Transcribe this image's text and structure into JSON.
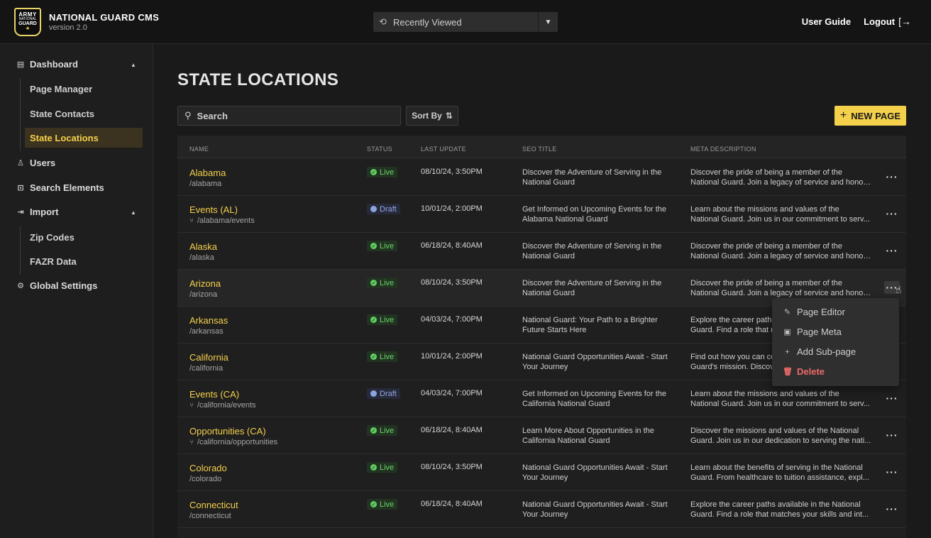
{
  "app": {
    "logo": {
      "line1": "ARMY",
      "line2": "NATIONAL",
      "line3": "GUARD"
    },
    "title": "NATIONAL GUARD CMS",
    "version": "version 2.0"
  },
  "recent": {
    "label": "Recently Viewed"
  },
  "topnav": {
    "guide": "User Guide",
    "logout": "Logout"
  },
  "sidebar": {
    "dashboard": "Dashboard",
    "page_manager": "Page Manager",
    "state_contacts": "State Contacts",
    "state_locations": "State Locations",
    "users": "Users",
    "search_elements": "Search Elements",
    "import": "Import",
    "zip_codes": "Zip Codes",
    "fazr_data": "FAZR Data",
    "global_settings": "Global Settings"
  },
  "page": {
    "title": "STATE LOCATIONS",
    "search_placeholder": "Search",
    "sort_label": "Sort By",
    "new_page": "NEW PAGE"
  },
  "table": {
    "headers": {
      "name": "NAME",
      "status": "STATUS",
      "updated": "LAST UPDATE",
      "seo": "SEO TITLE",
      "meta": "META DESCRIPTION"
    },
    "rows": [
      {
        "name": "Alabama",
        "path": "/alabama",
        "sub": false,
        "status": "Live",
        "updated": "08/10/24, 3:50PM",
        "seo": "Discover the Adventure of Serving in the National Guard",
        "meta1": "Discover the pride of being a member of the",
        "meta2": "National Guard. Join a legacy of service and honor..."
      },
      {
        "name": "Events (AL)",
        "path": "/alabama/events",
        "sub": true,
        "status": "Draft",
        "updated": "10/01/24, 2:00PM",
        "seo": "Get Informed on Upcoming Events for the Alabama National Guard",
        "meta1": "Learn about the missions and values of the",
        "meta2": "National Guard. Join us in our commitment to serv..."
      },
      {
        "name": "Alaska",
        "path": "/alaska",
        "sub": false,
        "status": "Live",
        "updated": "06/18/24, 8:40AM",
        "seo": "Discover the Adventure of Serving in the National Guard",
        "meta1": "Discover the pride of being a member of the",
        "meta2": "National Guard. Join a legacy of service and honor..."
      },
      {
        "name": "Arizona",
        "path": "/arizona",
        "sub": false,
        "status": "Live",
        "updated": "08/10/24, 3:50PM",
        "seo": "Discover the Adventure of Serving in the National Guard",
        "meta1": "Discover the pride of being a member of the",
        "meta2": "National Guard. Join a legacy of service and honor..."
      },
      {
        "name": "Arkansas",
        "path": "/arkansas",
        "sub": false,
        "status": "Live",
        "updated": "04/03/24, 7:00PM",
        "seo": "National Guard: Your Path to a Brighter Future Starts Here",
        "meta1": "Explore the career paths available in the National",
        "meta2": "Guard. Find a role that matches your skills and int..."
      },
      {
        "name": "California",
        "path": "/california",
        "sub": false,
        "status": "Live",
        "updated": "10/01/24, 2:00PM",
        "seo": "National Guard Opportunities Await - Start Your Journey",
        "meta1": "Find out how you can contribute to the National",
        "meta2": "Guard's mission. Discover opportunities..."
      },
      {
        "name": "Events (CA)",
        "path": "/california/events",
        "sub": true,
        "status": "Draft",
        "updated": "04/03/24, 7:00PM",
        "seo": "Get Informed on Upcoming Events for the California National Guard",
        "meta1": "Learn about the missions and values of the",
        "meta2": "National Guard. Join us in our commitment to serv..."
      },
      {
        "name": "Opportunities (CA)",
        "path": "/california/opportunities",
        "sub": true,
        "status": "Live",
        "updated": "06/18/24, 8:40AM",
        "seo": "Learn More About Opportunities in the California National Guard",
        "meta1": "Discover the missions and values of the National",
        "meta2": "Guard. Join us in our dedication to serving the nati..."
      },
      {
        "name": "Colorado",
        "path": "/colorado",
        "sub": false,
        "status": "Live",
        "updated": "08/10/24, 3:50PM",
        "seo": "National Guard Opportunities Await - Start Your Journey",
        "meta1": "Learn about the benefits of serving in the National",
        "meta2": "Guard. From healthcare to tuition assistance, expl..."
      },
      {
        "name": "Connecticut",
        "path": "/connecticut",
        "sub": false,
        "status": "Live",
        "updated": "06/18/24, 8:40AM",
        "seo": "National Guard Opportunities Await - Start Your Journey",
        "meta1": "Explore the career paths available in the National",
        "meta2": "Guard. Find a role that matches your skills and int..."
      }
    ]
  },
  "context_menu": {
    "page_editor": "Page Editor",
    "page_meta": "Page Meta",
    "add_subpage": "Add Sub-page",
    "delete": "Delete"
  },
  "colors": {
    "accent": "#f5d04b",
    "live": "#5fcf5f",
    "draft": "#8ea2e0",
    "danger": "#ef6a6a"
  }
}
